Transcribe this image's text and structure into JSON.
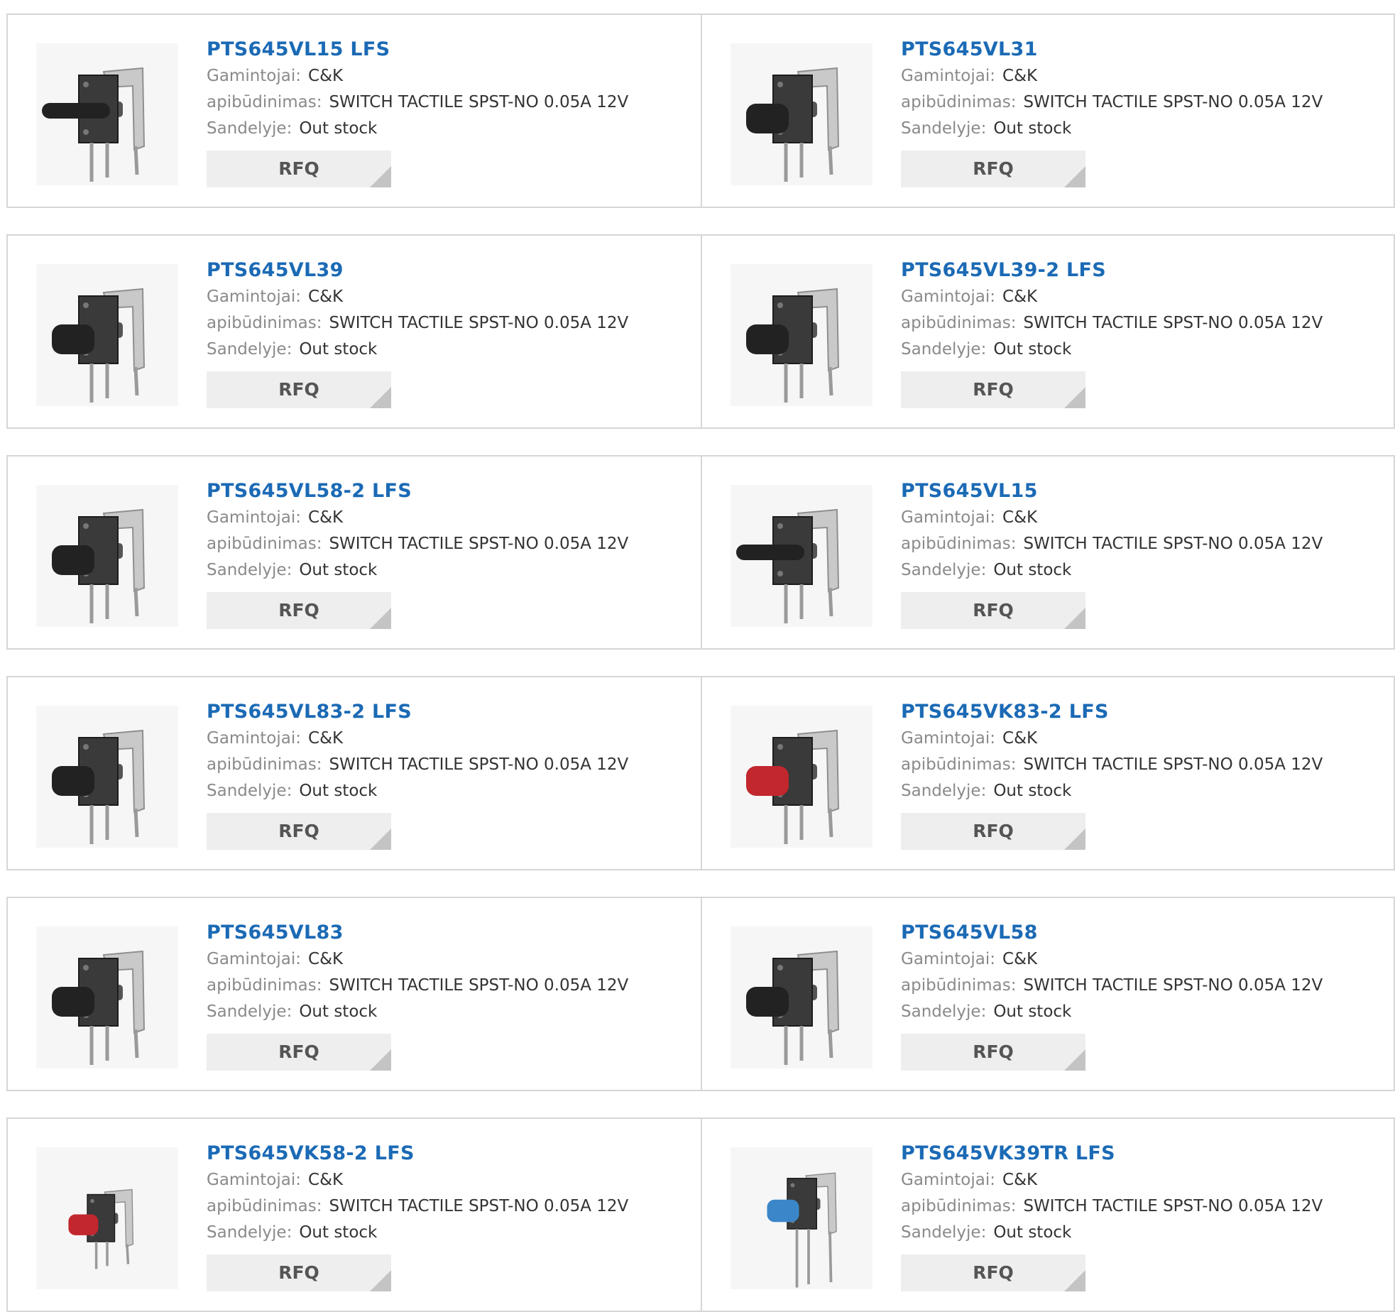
{
  "labels": {
    "manufacturer": "Gamintojai:",
    "description": "apibūdinimas:",
    "stock": "Sandelyje:",
    "rfq": "RFQ"
  },
  "products": [
    {
      "part": "PTS645VL15 LFS",
      "manufacturer": "C&K",
      "description": "SWITCH TACTILE SPST-NO 0.05A 12V",
      "stock": "Out stock",
      "icon": "long-black-actuator-switch-icon"
    },
    {
      "part": "PTS645VL31",
      "manufacturer": "C&K",
      "description": "SWITCH TACTILE SPST-NO 0.05A 12V",
      "stock": "Out stock",
      "icon": "black-tactile-switch-icon"
    },
    {
      "part": "PTS645VL39",
      "manufacturer": "C&K",
      "description": "SWITCH TACTILE SPST-NO 0.05A 12V",
      "stock": "Out stock",
      "icon": "black-tactile-switch-icon"
    },
    {
      "part": "PTS645VL39-2 LFS",
      "manufacturer": "C&K",
      "description": "SWITCH TACTILE SPST-NO 0.05A 12V",
      "stock": "Out stock",
      "icon": "black-tactile-switch-icon"
    },
    {
      "part": "PTS645VL58-2 LFS",
      "manufacturer": "C&K",
      "description": "SWITCH TACTILE SPST-NO 0.05A 12V",
      "stock": "Out stock",
      "icon": "black-actuator-switch-icon"
    },
    {
      "part": "PTS645VL15",
      "manufacturer": "C&K",
      "description": "SWITCH TACTILE SPST-NO 0.05A 12V",
      "stock": "Out stock",
      "icon": "long-black-actuator-switch-icon"
    },
    {
      "part": "PTS645VL83-2 LFS",
      "manufacturer": "C&K",
      "description": "SWITCH TACTILE SPST-NO 0.05A 12V",
      "stock": "Out stock",
      "icon": "black-actuator-switch-icon"
    },
    {
      "part": "PTS645VK83-2 LFS",
      "manufacturer": "C&K",
      "description": "SWITCH TACTILE SPST-NO 0.05A 12V",
      "stock": "Out stock",
      "icon": "red-actuator-switch-icon"
    },
    {
      "part": "PTS645VL83",
      "manufacturer": "C&K",
      "description": "SWITCH TACTILE SPST-NO 0.05A 12V",
      "stock": "Out stock",
      "icon": "black-actuator-switch-icon"
    },
    {
      "part": "PTS645VL58",
      "manufacturer": "C&K",
      "description": "SWITCH TACTILE SPST-NO 0.05A 12V",
      "stock": "Out stock",
      "icon": "black-actuator-switch-icon"
    },
    {
      "part": "PTS645VK58-2 LFS",
      "manufacturer": "C&K",
      "description": "SWITCH TACTILE SPST-NO 0.05A 12V",
      "stock": "Out stock",
      "icon": "small-red-actuator-switch-icon"
    },
    {
      "part": "PTS645VK39TR LFS",
      "manufacturer": "C&K",
      "description": "SWITCH TACTILE SPST-NO 0.05A 12V",
      "stock": "Out stock",
      "icon": "blue-actuator-switch-icon"
    }
  ],
  "colors": {
    "title": "#1b6ab5",
    "black_actuator": "#222222",
    "red_actuator": "#c1272d",
    "blue_actuator": "#3b86c9",
    "metal": "#c9c9c9"
  }
}
